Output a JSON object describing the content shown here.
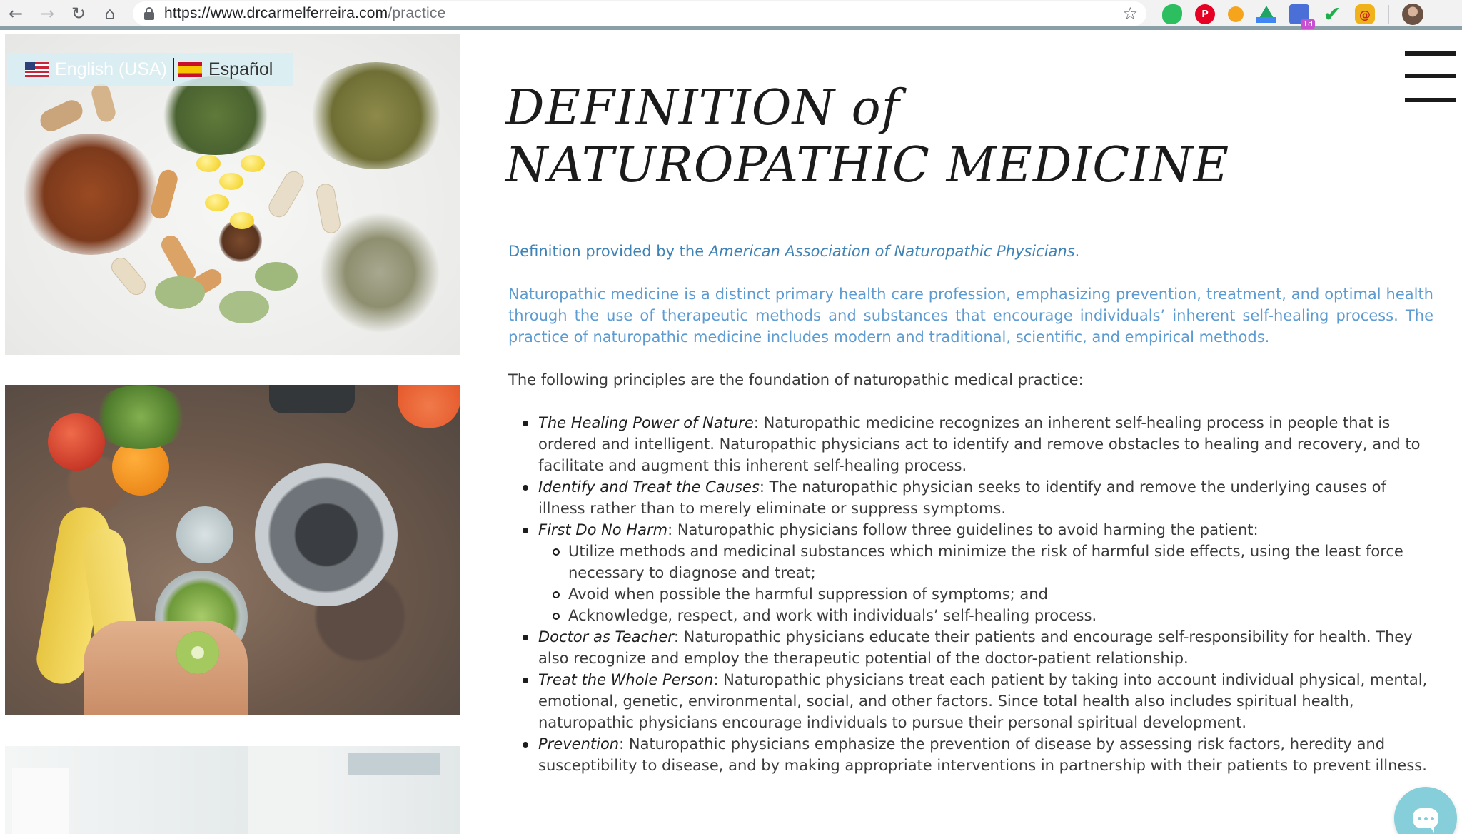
{
  "browser": {
    "url_host": "https://www.drcarmelferreira.com",
    "url_path": "/practice",
    "extensions": [
      "evernote-icon",
      "pinterest-icon",
      "honey-icon",
      "google-drive-icon",
      "calendar-icon",
      "checkmark-icon",
      "rss-icon"
    ],
    "calendar_badge": "1d"
  },
  "language": {
    "english_label": "English (USA)",
    "spanish_label": "Español"
  },
  "title": {
    "line1_main": "DEFINITION",
    "line1_of": "of",
    "line2": "NATUROPATHIC MEDICINE"
  },
  "content": {
    "source_prefix": "Definition provided by the ",
    "source_org": "American Association of Naturopathic Physicians",
    "source_suffix": ".",
    "definition": "Naturopathic medicine is a distinct primary health care profession, emphasizing prevention, treatment, and optimal health through the use of therapeutic methods and substances that encourage individuals’ inherent self-healing process.  The practice of naturopathic medicine includes modern and traditional, scientific, and empirical methods.",
    "principles_intro": "The following principles are the foundation of naturopathic medical practice:",
    "principles": [
      {
        "name": "The Healing Power of Nature",
        "text": ": Naturopathic medicine recognizes an inherent self-healing process in people that is ordered and intelligent. Naturopathic physicians act to identify and remove obstacles to healing and recovery, and to facilitate and augment this inherent self-healing process."
      },
      {
        "name": "Identify and Treat the Causes",
        "text": ": The naturopathic physician seeks to identify and remove the underlying causes of illness rather than to merely eliminate or suppress symptoms."
      },
      {
        "name": "First Do No Harm",
        "text": ": Naturopathic physicians follow three guidelines to avoid harming the patient:",
        "sub": [
          "Utilize methods and medicinal substances which minimize the risk of harmful side effects, using the least force necessary to diagnose and treat;",
          "Avoid when possible the harmful suppression of symptoms; and",
          "Acknowledge, respect, and work with individuals’ self-healing process."
        ]
      },
      {
        "name": "Doctor as Teacher",
        "text": ": Naturopathic physicians educate their patients and encourage self-responsibility for health. They also recognize and employ the therapeutic potential of the doctor-patient relationship."
      },
      {
        "name": "Treat the Whole Person",
        "text": ": Naturopathic physicians treat each patient by taking into account individual physical, mental, emotional, genetic, environmental, social, and other factors. Since total health also includes spiritual health, naturopathic physicians encourage individuals to pursue their personal spiritual development."
      },
      {
        "name": "Prevention",
        "text": ": Naturopathic physicians emphasize the prevention of disease by assessing risk factors, heredity and susceptibility to disease, and by making appropriate interventions in partnership with their patients to prevent illness."
      }
    ]
  },
  "colors": {
    "source_blue": "#3e82b6",
    "definition_blue": "#5d9bd1",
    "chat_teal": "#86ced9"
  }
}
